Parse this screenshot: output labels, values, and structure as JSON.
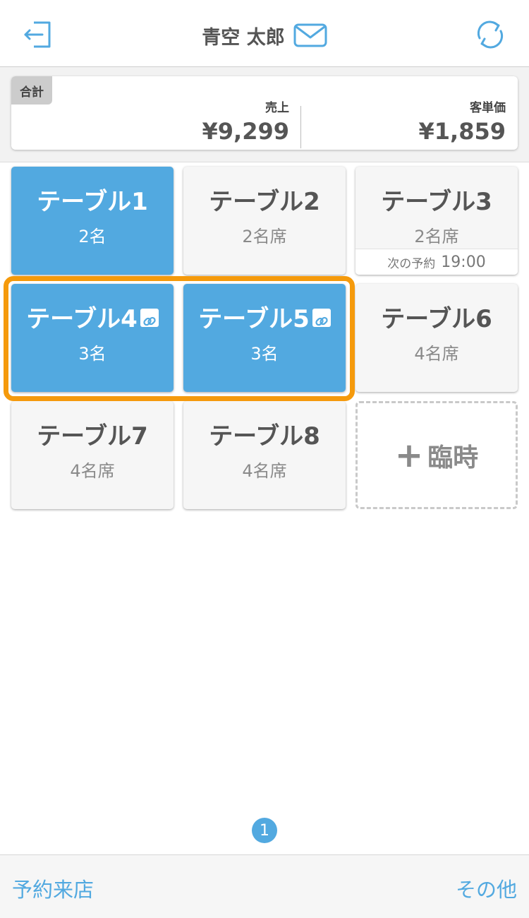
{
  "header": {
    "user_name": "青空 太郎",
    "logout_icon": "logout-icon",
    "mail_icon": "mail-icon",
    "refresh_icon": "refresh-icon"
  },
  "summary": {
    "tag": "合計",
    "sales_label": "売上",
    "sales_value": "¥9,299",
    "avg_label": "客単価",
    "avg_value": "¥1,859"
  },
  "tables": [
    {
      "name": "テーブル1",
      "capacity": "2名",
      "active": true
    },
    {
      "name": "テーブル2",
      "capacity": "2名席",
      "active": false
    },
    {
      "name": "テーブル3",
      "capacity": "2名席",
      "active": false,
      "reservation_label": "次の予約",
      "reservation_time": "19:00"
    },
    {
      "name": "テーブル4",
      "capacity": "3名",
      "active": true,
      "linked": true
    },
    {
      "name": "テーブル5",
      "capacity": "3名",
      "active": true,
      "linked": true
    },
    {
      "name": "テーブル6",
      "capacity": "4名席",
      "active": false
    },
    {
      "name": "テーブル7",
      "capacity": "4名席",
      "active": false
    },
    {
      "name": "テーブル8",
      "capacity": "4名席",
      "active": false
    }
  ],
  "temporary": {
    "plus": "+",
    "label": "臨時"
  },
  "pager": {
    "current": "1"
  },
  "footer": {
    "left": "予約来店",
    "right": "その他"
  },
  "colors": {
    "accent": "#52a9e0",
    "highlight": "#f59a0c"
  }
}
